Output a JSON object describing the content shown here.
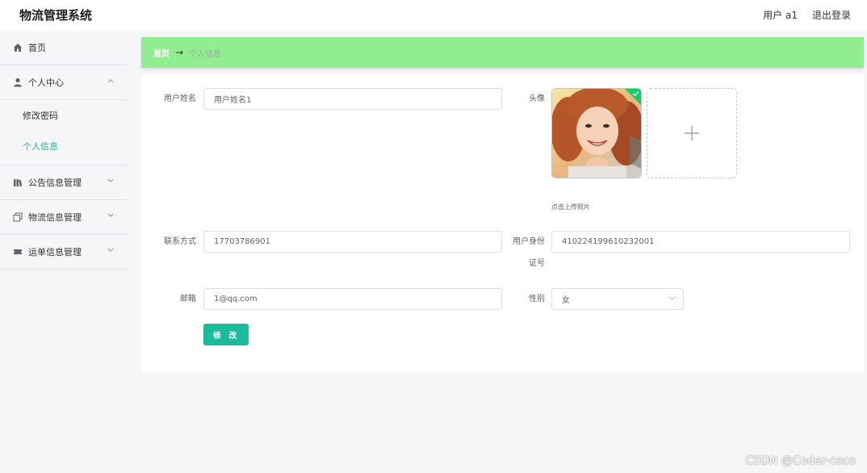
{
  "header": {
    "app_title": "物流管理系统",
    "user_label": "用户 a1",
    "logout_label": "退出登录"
  },
  "sidebar": {
    "items": [
      {
        "label": "首页",
        "icon": "home-icon"
      },
      {
        "label": "个人中心",
        "icon": "user-icon",
        "expanded": true,
        "children": [
          {
            "label": "修改密码"
          },
          {
            "label": "个人信息",
            "active": true
          }
        ]
      },
      {
        "label": "公告信息管理",
        "icon": "library-icon"
      },
      {
        "label": "物流信息管理",
        "icon": "copy-icon"
      },
      {
        "label": "运单信息管理",
        "icon": "ticket-icon"
      }
    ]
  },
  "breadcrumb": {
    "home": "首页",
    "separator": "→",
    "current": "个人信息"
  },
  "form": {
    "username_label": "用户姓名",
    "username_value": "用户姓名1",
    "avatar_label": "头像",
    "upload_tip": "点击上传照片",
    "phone_label": "联系方式",
    "phone_value": "17703786901",
    "idcard_label_line1": "用户身份",
    "idcard_label_line2": "证号",
    "idcard_value": "410224199610232001",
    "email_label": "邮箱",
    "email_value": "1@qq.com",
    "gender_label": "性别",
    "gender_value": "女",
    "submit_label": "修 改"
  },
  "watermark": "CSDN @Coder-coco",
  "colors": {
    "accent": "#1abc9c",
    "breadcrumb_bg": "#90ee90",
    "active_menu": "#1abc9c"
  }
}
